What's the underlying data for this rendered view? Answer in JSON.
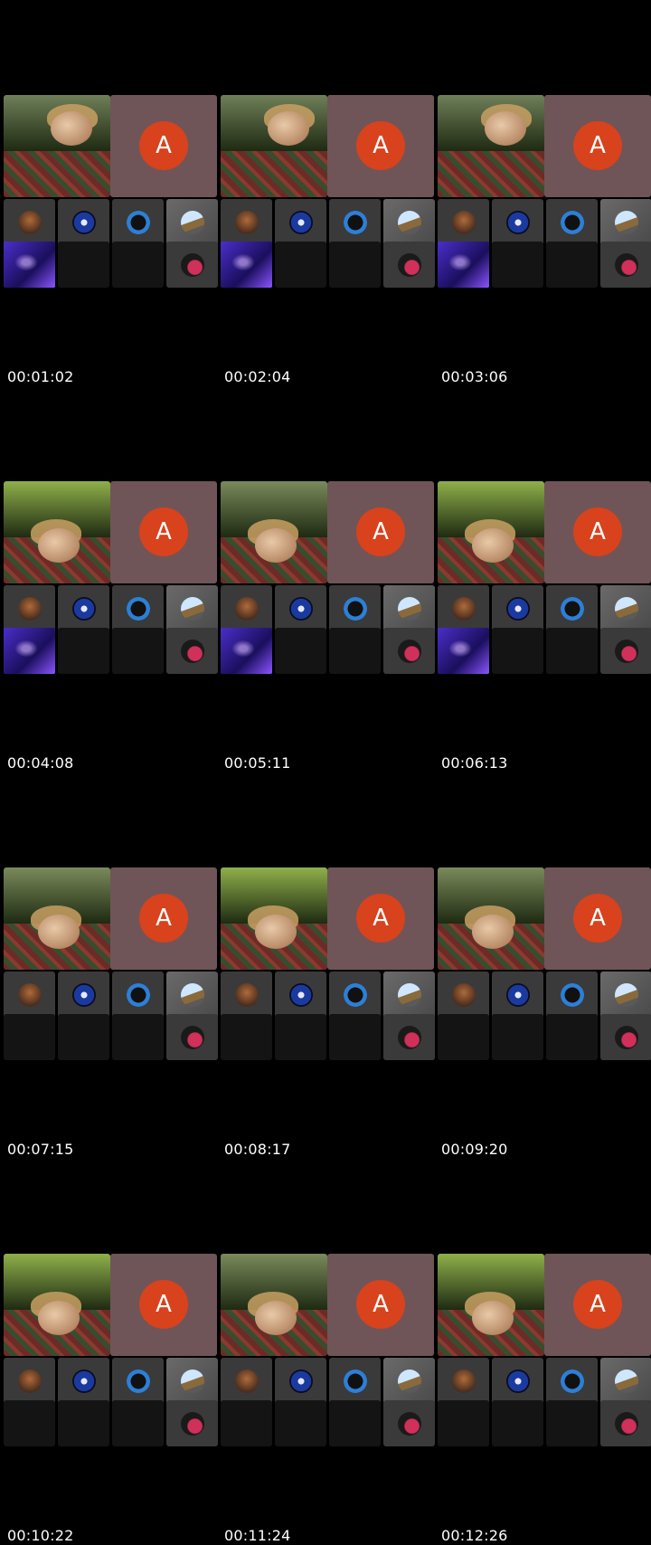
{
  "thumbnails": [
    {
      "timestamp": "00:01:02",
      "avatar_letter": "A",
      "has_screen_share": true
    },
    {
      "timestamp": "00:02:04",
      "avatar_letter": "A",
      "has_screen_share": true
    },
    {
      "timestamp": "00:03:06",
      "avatar_letter": "A",
      "has_screen_share": true
    },
    {
      "timestamp": "00:04:08",
      "avatar_letter": "A",
      "has_screen_share": true
    },
    {
      "timestamp": "00:05:11",
      "avatar_letter": "A",
      "has_screen_share": true
    },
    {
      "timestamp": "00:06:13",
      "avatar_letter": "A",
      "has_screen_share": true
    },
    {
      "timestamp": "00:07:15",
      "avatar_letter": "A",
      "has_screen_share": false
    },
    {
      "timestamp": "00:08:17",
      "avatar_letter": "A",
      "has_screen_share": false
    },
    {
      "timestamp": "00:09:20",
      "avatar_letter": "A",
      "has_screen_share": false
    },
    {
      "timestamp": "00:10:22",
      "avatar_letter": "A",
      "has_screen_share": false
    },
    {
      "timestamp": "00:11:24",
      "avatar_letter": "A",
      "has_screen_share": false
    },
    {
      "timestamp": "00:12:26",
      "avatar_letter": "A",
      "has_screen_share": false
    }
  ],
  "participant_icons": [
    "bottle-icon",
    "eagle-emblem-icon",
    "dark-emblem-icon",
    "dome-icon"
  ],
  "bottom_icon": "pink-swirl-icon",
  "colors": {
    "background": "#000000",
    "avatar_tile": "#6f5557",
    "avatar_circle": "#d8421d",
    "timestamp_text": "#ffffff"
  }
}
